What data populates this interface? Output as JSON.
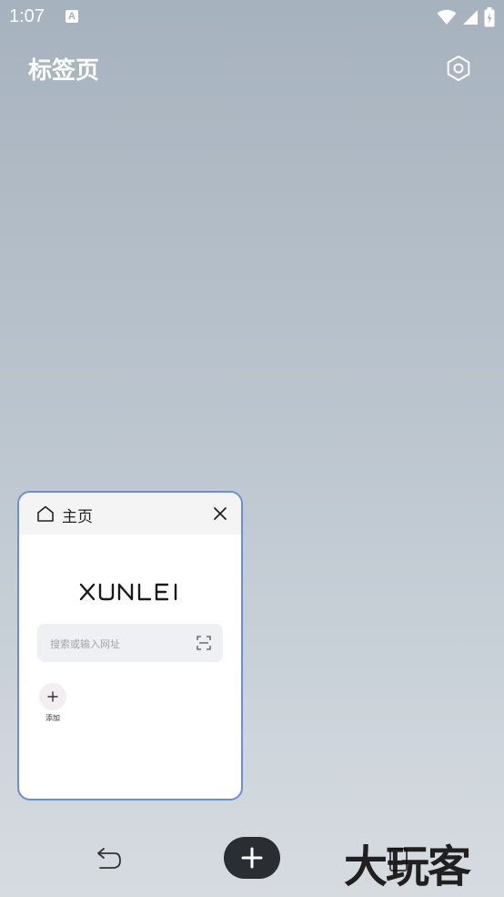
{
  "status_bar": {
    "time": "1:07",
    "notification_icon": "A"
  },
  "header": {
    "title": "标签页",
    "settings_icon": "settings-hexagon-icon"
  },
  "tab_card": {
    "title": "主页",
    "logo_text": "XUNLEI",
    "search_placeholder": "搜索或输入网址",
    "add_label": "添加",
    "border_color": "#6b8ed8"
  },
  "bottom_bar": {
    "new_tab_icon": "plus-icon"
  },
  "watermark": "大玩客"
}
